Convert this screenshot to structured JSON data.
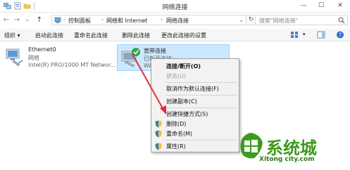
{
  "window": {
    "title": "网络连接",
    "minimize_glyph": "—",
    "maximize_glyph": "☐",
    "close_glyph": "✕"
  },
  "address": {
    "back_glyph": "←",
    "forward_glyph": "→",
    "recent_glyph": "⌄",
    "up_glyph": "↑",
    "refresh_glyph": "↻",
    "crumbs": [
      "控制面板",
      "网络和 Internet",
      "网络连接"
    ],
    "search_placeholder": "搜索\"网络连接\""
  },
  "toolbar": {
    "items": [
      "组织 ▾",
      "启动此连接",
      "重命名此连接",
      "删除此连接",
      "更改此连接的设置"
    ]
  },
  "adapters": [
    {
      "name": "Ethernet0",
      "network": "网络",
      "device": "Intel(R) PRO/1000 MT Networ..."
    },
    {
      "name": "宽带连接",
      "network": "已断开连接",
      "device": "WA..."
    }
  ],
  "context_menu": {
    "items": [
      {
        "label": "连接/断开(O)",
        "bold": true,
        "disabled": false,
        "shield": false
      },
      {
        "label": "状态(U)",
        "bold": false,
        "disabled": true,
        "shield": false
      },
      {
        "label": "取消作为默认连接(F)",
        "bold": false,
        "disabled": false,
        "shield": false
      },
      {
        "label": "创建副本(C)",
        "bold": false,
        "disabled": false,
        "shield": false
      },
      {
        "label": "创建快捷方式(S)",
        "bold": false,
        "disabled": false,
        "shield": false
      },
      {
        "label": "删除(D)",
        "bold": false,
        "disabled": false,
        "shield": true
      },
      {
        "label": "重命名(M)",
        "bold": false,
        "disabled": false,
        "shield": true
      },
      {
        "label": "属性(R)",
        "bold": false,
        "disabled": false,
        "shield": true
      }
    ]
  },
  "watermark": {
    "name": "系统城",
    "url": "Xitong city.com"
  },
  "colors": {
    "selection": "#cce8ff",
    "arrow": "#e0303a",
    "watermark": "#3d9a1d",
    "connected_check": "#2aa845"
  }
}
